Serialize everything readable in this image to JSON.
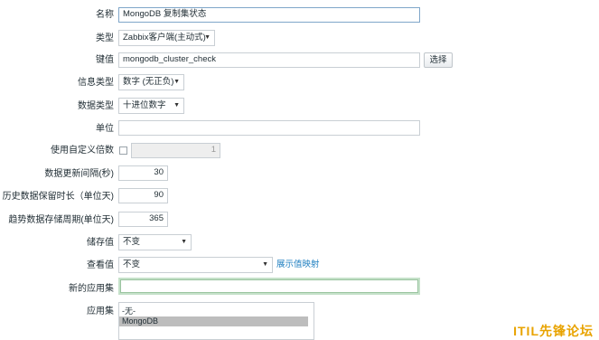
{
  "form": {
    "name": {
      "label": "名称",
      "value": "MongoDB 复制集状态"
    },
    "type": {
      "label": "类型",
      "value": "Zabbix客户端(主动式)"
    },
    "key": {
      "label": "键值",
      "value": "mongodb_cluster_check",
      "button": "选择"
    },
    "info_type": {
      "label": "信息类型",
      "value": "数字 (无正负)"
    },
    "data_type": {
      "label": "数据类型",
      "value": "十进位数字"
    },
    "unit": {
      "label": "单位",
      "value": ""
    },
    "custom_multiplier": {
      "label": "使用自定义倍数",
      "value": "1"
    },
    "update_interval": {
      "label": "数据更新间隔(秒)",
      "value": "30"
    },
    "history": {
      "label": "历史数据保留时长（单位天)",
      "value": "90"
    },
    "trends": {
      "label": "趋势数据存储周期(单位天)",
      "value": "365"
    },
    "store_value": {
      "label": "储存值",
      "value": "不变"
    },
    "show_value": {
      "label": "查看值",
      "value": "不变",
      "link": "展示值映射"
    },
    "new_app": {
      "label": "新的应用集",
      "value": ""
    },
    "apps": {
      "label": "应用集",
      "options": [
        "-无-",
        "MongoDB"
      ],
      "selected": "MongoDB"
    }
  },
  "watermark": "ITIL先锋论坛"
}
